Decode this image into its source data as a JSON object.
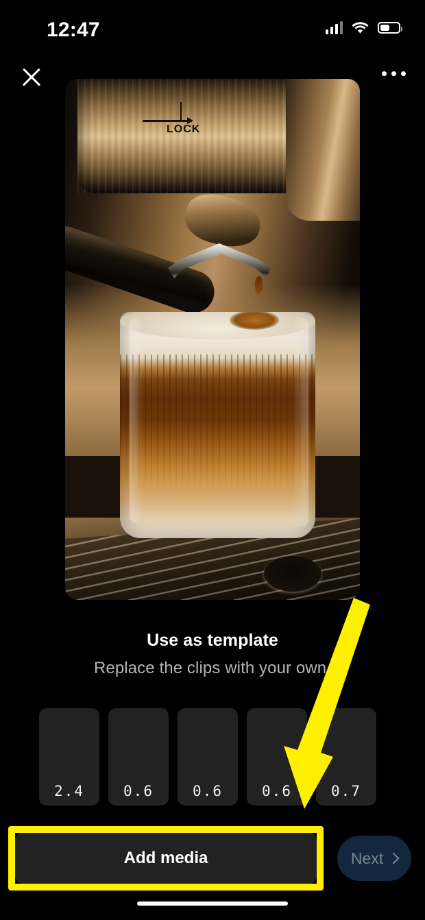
{
  "status_bar": {
    "time": "12:47",
    "signal_icon": "cellular-signal-icon",
    "signal_bars_filled": 3,
    "signal_bars_total": 4,
    "wifi_icon": "wifi-icon",
    "battery_icon": "battery-icon",
    "battery_level_percent": 44
  },
  "top_nav": {
    "close_icon": "close-x-icon",
    "more_icon": "more-options-ellipsis-icon"
  },
  "preview": {
    "media_type": "video-preview",
    "description": "Espresso machine group head pouring into a glass of layered coffee"
  },
  "caption": {
    "title": "Use as template",
    "subtitle": "Replace the clips with your own."
  },
  "clips": {
    "items": [
      {
        "duration": "2.4"
      },
      {
        "duration": "0.6"
      },
      {
        "duration": "0.6"
      },
      {
        "duration": "0.6"
      },
      {
        "duration": "0.7"
      }
    ]
  },
  "bottom_bar": {
    "add_media_label": "Add media",
    "next_label": "Next",
    "next_chevron_icon": "chevron-right-icon",
    "next_enabled": false
  },
  "annotation": {
    "arrow_icon": "yellow-arrow-icon",
    "highlight_color": "#fff000",
    "points_to": "Add media"
  },
  "colors": {
    "background": "#000000",
    "surface": "#222222",
    "highlight": "#fff000",
    "next_button_bg": "#13283f",
    "next_button_text": "#7b8794",
    "subtitle_text": "#b4b4b4",
    "primary_text": "#ffffff"
  }
}
